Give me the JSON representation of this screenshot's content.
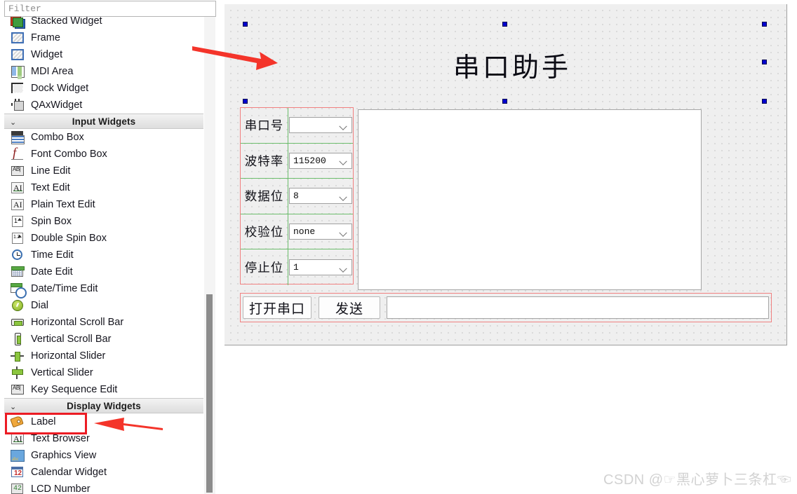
{
  "widget_box": {
    "filter": {
      "placeholder": "Filter",
      "value": ""
    },
    "groups": [
      {
        "name": "containers-partial",
        "header": null,
        "items": [
          {
            "label": "Stacked Widget",
            "icon": "stacked-widget-icon"
          },
          {
            "label": "Frame",
            "icon": "frame-icon"
          },
          {
            "label": "Widget",
            "icon": "widget-icon"
          },
          {
            "label": "MDI Area",
            "icon": "mdi-area-icon"
          },
          {
            "label": "Dock Widget",
            "icon": "dock-widget-icon"
          },
          {
            "label": "QAxWidget",
            "icon": "qax-widget-icon"
          }
        ]
      },
      {
        "name": "input-widgets",
        "header": "Input Widgets",
        "items": [
          {
            "label": "Combo Box",
            "icon": "combo-box-icon"
          },
          {
            "label": "Font Combo Box",
            "icon": "font-combo-box-icon"
          },
          {
            "label": "Line Edit",
            "icon": "line-edit-icon"
          },
          {
            "label": "Text Edit",
            "icon": "text-edit-icon"
          },
          {
            "label": "Plain Text Edit",
            "icon": "plain-text-edit-icon"
          },
          {
            "label": "Spin Box",
            "icon": "spin-box-icon"
          },
          {
            "label": "Double Spin Box",
            "icon": "double-spin-box-icon"
          },
          {
            "label": "Time Edit",
            "icon": "time-edit-icon"
          },
          {
            "label": "Date Edit",
            "icon": "date-edit-icon"
          },
          {
            "label": "Date/Time Edit",
            "icon": "date-time-edit-icon"
          },
          {
            "label": "Dial",
            "icon": "dial-icon"
          },
          {
            "label": "Horizontal Scroll Bar",
            "icon": "horizontal-scroll-bar-icon"
          },
          {
            "label": "Vertical Scroll Bar",
            "icon": "vertical-scroll-bar-icon"
          },
          {
            "label": "Horizontal Slider",
            "icon": "horizontal-slider-icon"
          },
          {
            "label": "Vertical Slider",
            "icon": "vertical-slider-icon"
          },
          {
            "label": "Key Sequence Edit",
            "icon": "key-sequence-edit-icon"
          }
        ]
      },
      {
        "name": "display-widgets",
        "header": "Display Widgets",
        "items": [
          {
            "label": "Label",
            "icon": "label-icon"
          },
          {
            "label": "Text Browser",
            "icon": "text-browser-icon"
          },
          {
            "label": "Graphics View",
            "icon": "graphics-view-icon"
          },
          {
            "label": "Calendar Widget",
            "icon": "calendar-widget-icon"
          },
          {
            "label": "LCD Number",
            "icon": "lcd-number-icon"
          }
        ]
      }
    ]
  },
  "form": {
    "title": "串口助手",
    "settings": [
      {
        "label": "串口号",
        "value": "",
        "control": "combo-box"
      },
      {
        "label": "波特率",
        "value": "115200",
        "control": "combo-box"
      },
      {
        "label": "数据位",
        "value": "8",
        "control": "combo-box"
      },
      {
        "label": "校验位",
        "value": "none",
        "control": "combo-box"
      },
      {
        "label": "停止位",
        "value": "1",
        "control": "combo-box"
      }
    ],
    "receive_area": {
      "value": ""
    },
    "buttons": {
      "open_port": "打开串口",
      "send": "发送"
    },
    "send_input": {
      "value": ""
    }
  },
  "annotations": {
    "highlight_target": "Label",
    "arrow_count": 2,
    "arrow_color": "#f4342a",
    "highlight_color": "#ec1c24"
  },
  "watermark": {
    "text": "CSDN @☞黑心萝卜三条杠☜"
  },
  "colors": {
    "canvas_background": "#efefef",
    "selection_handle": "#0000d0",
    "layout_outline_red": "#f08080",
    "layout_outline_green": "#6cbd6c",
    "panel_background": "#ffffff"
  }
}
